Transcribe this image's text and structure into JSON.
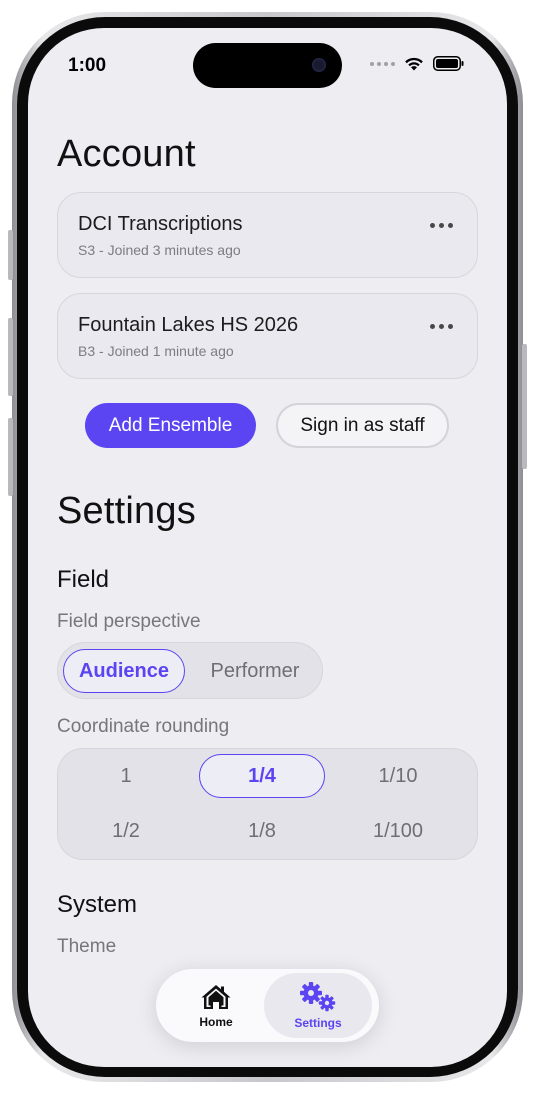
{
  "status_bar": {
    "time": "1:00"
  },
  "account": {
    "title": "Account",
    "ensembles": [
      {
        "name": "DCI Transcriptions",
        "detail": "S3 - Joined 3 minutes ago"
      },
      {
        "name": "Fountain Lakes HS 2026",
        "detail": "B3 - Joined 1 minute ago"
      }
    ],
    "add_button": "Add Ensemble",
    "staff_button": "Sign in as staff"
  },
  "settings": {
    "title": "Settings",
    "field": {
      "heading": "Field",
      "perspective_label": "Field perspective",
      "perspective_options": [
        "Audience",
        "Performer"
      ],
      "perspective_selected": "Audience",
      "rounding_label": "Coordinate rounding",
      "rounding_options": [
        "1",
        "1/4",
        "1/10",
        "1/2",
        "1/8",
        "1/100"
      ],
      "rounding_selected": "1/4"
    },
    "system": {
      "heading": "System",
      "theme_label": "Theme"
    }
  },
  "tab_bar": {
    "tabs": [
      {
        "label": "Home",
        "icon": "house-icon"
      },
      {
        "label": "Settings",
        "icon": "gears-icon"
      }
    ],
    "active": "Settings"
  },
  "colors": {
    "accent": "#5b45f2",
    "background": "#ededf2",
    "card": "#e9e9ef",
    "secondary_text": "#76767c"
  }
}
